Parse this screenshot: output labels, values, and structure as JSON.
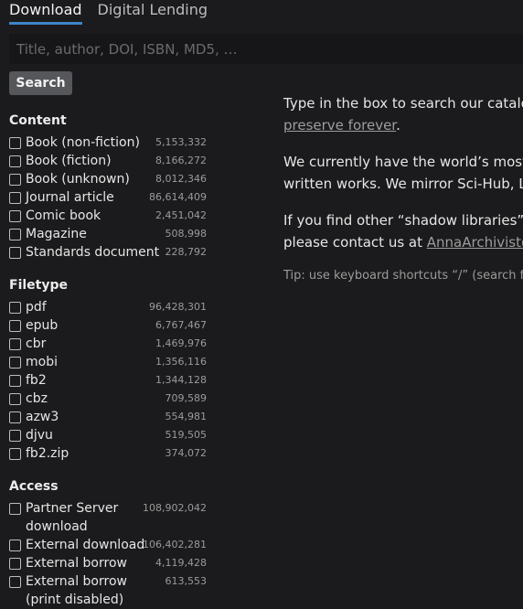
{
  "tabs": {
    "download": "Download",
    "digital_lending": "Digital Lending"
  },
  "search": {
    "placeholder": "Title, author, DOI, ISBN, MD5, …",
    "button": "Search"
  },
  "filters": {
    "content": {
      "title": "Content",
      "items": [
        {
          "label": "Book (non-fiction)",
          "count": "5,153,332"
        },
        {
          "label": "Book (fiction)",
          "count": "8,166,272"
        },
        {
          "label": "Book (unknown)",
          "count": "8,012,346"
        },
        {
          "label": "Journal article",
          "count": "86,614,409"
        },
        {
          "label": "Comic book",
          "count": "2,451,042"
        },
        {
          "label": "Magazine",
          "count": "508,998"
        },
        {
          "label": "Standards document",
          "count": "228,792"
        }
      ]
    },
    "filetype": {
      "title": "Filetype",
      "items": [
        {
          "label": "pdf",
          "count": "96,428,301"
        },
        {
          "label": "epub",
          "count": "6,767,467"
        },
        {
          "label": "cbr",
          "count": "1,469,976"
        },
        {
          "label": "mobi",
          "count": "1,356,116"
        },
        {
          "label": "fb2",
          "count": "1,344,128"
        },
        {
          "label": "cbz",
          "count": "709,589"
        },
        {
          "label": "azw3",
          "count": "554,981"
        },
        {
          "label": "djvu",
          "count": "519,505"
        },
        {
          "label": "fb2.zip",
          "count": "374,072"
        }
      ]
    },
    "access": {
      "title": "Access",
      "items": [
        {
          "label": "Partner Server download",
          "count": "108,902,042"
        },
        {
          "label": "External download",
          "count": "106,402,281"
        },
        {
          "label": "External borrow",
          "count": "4,119,428"
        },
        {
          "label": "External borrow (print disabled)",
          "count": "613,553"
        }
      ]
    }
  },
  "main": {
    "p1_line1": "Type in the box to search our catalog",
    "p1_link": "preserve forever",
    "p1_end": ".",
    "p2_line1": "We currently have the world’s most c",
    "p2_line2": "written works. We mirror Sci-Hub, Lib",
    "p3_line1": "If you find other “shadow libraries” t",
    "p3_line2_prefix": "please contact us at ",
    "p3_email": "AnnaArchivist@",
    "tip": "Tip: use keyboard shortcuts “/” (search foc"
  }
}
